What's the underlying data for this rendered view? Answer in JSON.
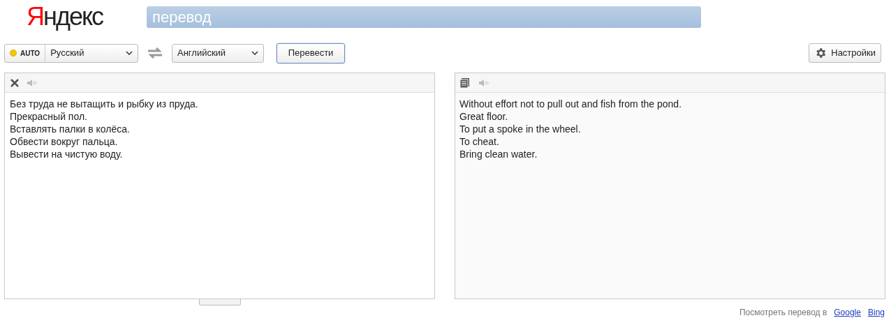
{
  "logo": {
    "text": "Яндекс"
  },
  "search": {
    "value": "перевод"
  },
  "toolbar": {
    "auto_label": "AUTO",
    "source_language": "Русский",
    "target_language": "Английский",
    "translate_button": "Перевести",
    "settings_button": "Настройки"
  },
  "source": {
    "lines": [
      "Без труда не вытащить и рыбку из пруда.",
      "Прекрасный пол.",
      "Вставлять палки в колёса.",
      "Обвести вокруг пальца.",
      "Вывести на чистую воду."
    ]
  },
  "result": {
    "lines": [
      "Without effort not to pull out and fish from the pond.",
      "Great floor.",
      "To put a spoke in the wheel.",
      "To cheat.",
      "Bring clean water."
    ]
  },
  "footer": {
    "label": "Посмотреть перевод в",
    "links": [
      "Google",
      "Bing"
    ]
  }
}
